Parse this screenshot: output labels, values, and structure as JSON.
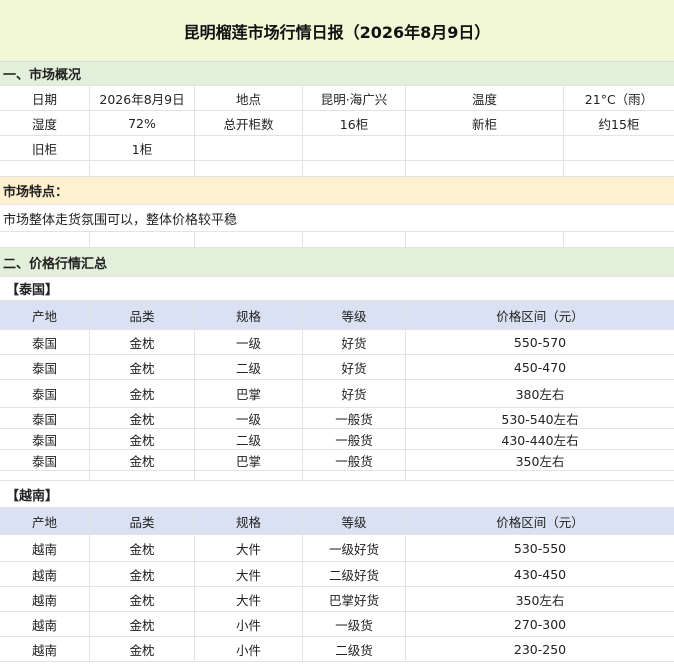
{
  "title": "昆明榴莲市场行情日报（2026年8月9日）",
  "overview": {
    "section_title": "一、市场概况",
    "rows": [
      [
        "日期",
        "2026年8月9日",
        "地点",
        "昆明·海广兴",
        "温度",
        "21°C（雨）"
      ],
      [
        "湿度",
        "72%",
        "总开柜数",
        "16柜",
        "新柜",
        "约15柜"
      ],
      [
        "旧柜",
        "1柜",
        "",
        "",
        "",
        ""
      ]
    ]
  },
  "features": {
    "title": "市场特点：",
    "text": "市场整体走货氛围可以，整体价格较平稳"
  },
  "price": {
    "section_title": "二、价格行情汇总",
    "headers": [
      "产地",
      "品类",
      "规格",
      "等级",
      "价格区间（元）"
    ],
    "thailand": {
      "label": "【泰国】",
      "rows": [
        [
          "泰国",
          "金枕",
          "一级",
          "好货",
          "550-570"
        ],
        [
          "泰国",
          "金枕",
          "二级",
          "好货",
          "450-470"
        ],
        [
          "泰国",
          "金枕",
          "巴掌",
          "好货",
          "380左右"
        ],
        [
          "泰国",
          "金枕",
          "一级",
          "一般货",
          "530-540左右"
        ],
        [
          "泰国",
          "金枕",
          "二级",
          "一般货",
          "430-440左右"
        ],
        [
          "泰国",
          "金枕",
          "巴掌",
          "一般货",
          "350左右"
        ]
      ]
    },
    "vietnam": {
      "label": "【越南】",
      "rows": [
        [
          "越南",
          "金枕",
          "大件",
          "一级好货",
          "530-550"
        ],
        [
          "越南",
          "金枕",
          "大件",
          "二级好货",
          "430-450"
        ],
        [
          "越南",
          "金枕",
          "大件",
          "巴掌好货",
          "350左右"
        ],
        [
          "越南",
          "金枕",
          "小件",
          "一级货",
          "270-300"
        ],
        [
          "越南",
          "金枕",
          "小件",
          "二级货",
          "230-250"
        ]
      ]
    }
  }
}
